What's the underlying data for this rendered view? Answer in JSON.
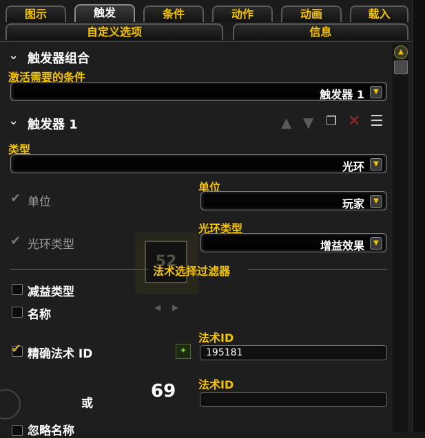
{
  "tabs": [
    "图示",
    "触发",
    "条件",
    "动作",
    "动画",
    "载入"
  ],
  "active_tab_index": 1,
  "tabs_row2": [
    "自定义选项",
    "信息"
  ],
  "trigger_group": {
    "title": "触发器组合",
    "activation_label": "激活需要的条件",
    "activation_value": "触发器 1"
  },
  "trigger1": {
    "title": "触发器 1",
    "type_label": "类型",
    "type_value": "光环",
    "unit_checkbox_label": "单位",
    "unit_label": "单位",
    "unit_value": "玩家",
    "aura_type_checkbox_label": "光环类型",
    "aura_type_label": "光环类型",
    "aura_type_value": "增益效果",
    "filter_header": "法术选择过滤器",
    "debuff_type_label": "减益类型",
    "name_label": "名称",
    "exact_spell_label": "精确法术 ID",
    "spell_id_label": "法术ID",
    "spell_id_value": "195181",
    "or_label": "或",
    "number_69": "69",
    "spell_id_label2": "法术ID",
    "spell_id_value2": "",
    "ignore_name_label": "忽略名称",
    "icon_number": "52"
  },
  "colors": {
    "gold": "#f5c400",
    "bg": "#1e1e1f"
  }
}
